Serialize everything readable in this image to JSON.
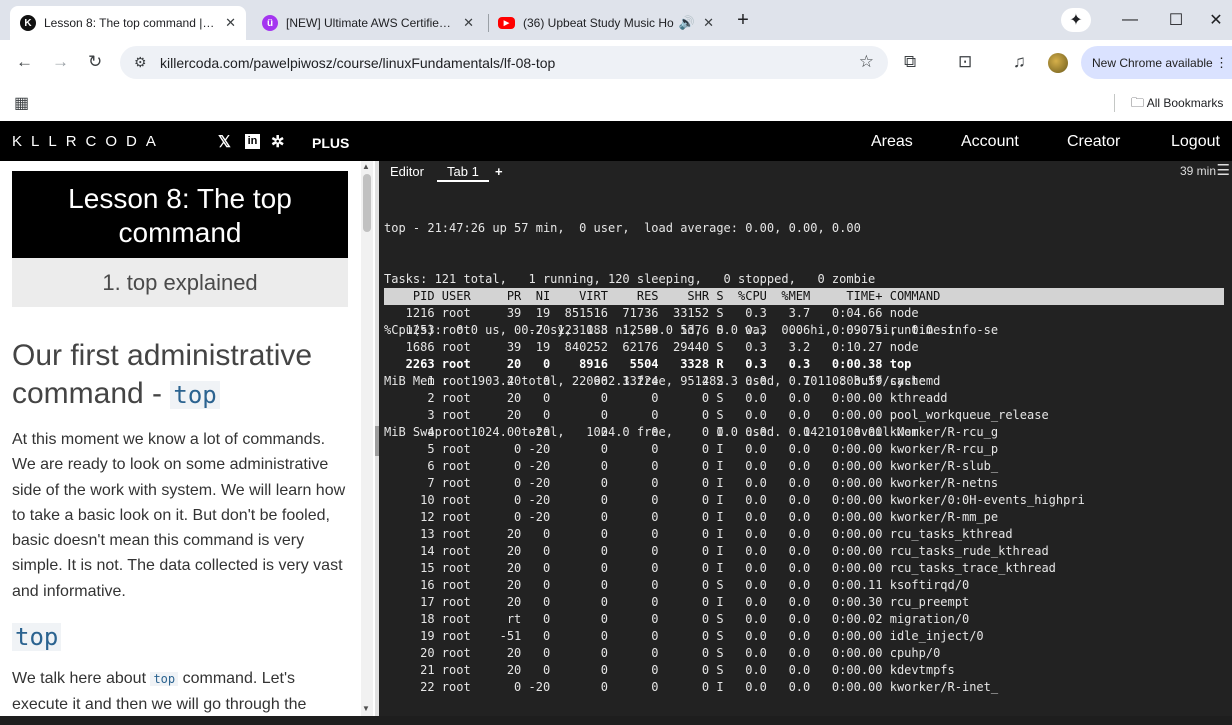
{
  "browser": {
    "tabs": [
      {
        "title": "Lesson 8: The top command | Pa",
        "favicon": "killercoda-icon",
        "active": true
      },
      {
        "title": "[NEW] Ultimate AWS Certified C",
        "favicon": "udemy-icon",
        "active": false
      },
      {
        "title": "(36) Upbeat Study Music Ho",
        "favicon": "youtube-icon",
        "active": false
      }
    ],
    "url": "killercoda.com/pawelpiwosz/course/linuxFundamentals/lf-08-top",
    "new_chrome": "New Chrome available",
    "all_bookmarks": "All Bookmarks"
  },
  "site": {
    "logo": "KLLRCODA",
    "plus": "PLUS",
    "nav": [
      "Areas",
      "Account",
      "Creator",
      "Logout"
    ]
  },
  "lesson": {
    "title": "Lesson 8: The top command",
    "step": "1. top explained",
    "heading_text": "Our first administrative command - ",
    "heading_code": "top",
    "paragraph": "At this moment we know a lot of commands. We are ready to look on some administrative side of the work with system. We will learn how to take a basic look on it. But don't be fooled, basic doesn't mean this command is very simple. It is not. The data collected is very vast and informative.",
    "subheading_code": "top",
    "para2_prefix": "We talk here about ",
    "para2_code": "top",
    "para2_suffix": " command. Let's execute it and then we will go through the"
  },
  "terminal": {
    "tabs": [
      "Editor",
      "Tab 1"
    ],
    "add_tab": "+",
    "timer": "39 min",
    "summary": [
      "top - 21:47:26 up 57 min,  0 user,  load average: 0.00, 0.00, 0.00",
      "Tasks: 121 total,   1 running, 120 sleeping,   0 stopped,   0 zombie",
      "%Cpu(s):  0.0 us,  0.7 sy,  0.3 ni, 99.0 id,  0.0 wa,  0.0 hi,  0.0 si,  0.0 st",
      "MiB Mem :   1903.4 total,    602.3 free,    482.3 used,   1011.8 buff/cache",
      "MiB Swap:   1024.0 total,   1024.0 free,      0.0 used.   1421.1 avail Mem"
    ],
    "columns": [
      "PID",
      "USER",
      "PR",
      "NI",
      "VIRT",
      "RES",
      "SHR",
      "S",
      "%CPU",
      "%MEM",
      "TIME+",
      "COMMAND"
    ],
    "processes": [
      [
        "1216",
        "root",
        "39",
        "19",
        "851516",
        "71736",
        "33152",
        "S",
        "0.3",
        "3.7",
        "0:04.66",
        "node"
      ],
      [
        "1253",
        "root",
        "0",
        "-20",
        "1231188",
        "12568",
        "5376",
        "S",
        "0.3",
        "0.6",
        "0:09.75",
        "runtime-info-se"
      ],
      [
        "1686",
        "root",
        "39",
        "19",
        "840252",
        "62176",
        "29440",
        "S",
        "0.3",
        "3.2",
        "0:10.27",
        "node"
      ],
      [
        "2263",
        "root",
        "20",
        "0",
        "8916",
        "5504",
        "3328",
        "R",
        "0.3",
        "0.3",
        "0:00.38",
        "top"
      ],
      [
        "1",
        "root",
        "20",
        "0",
        "22096",
        "13224",
        "9512",
        "S",
        "0.0",
        "0.7",
        "0:03.59",
        "systemd"
      ],
      [
        "2",
        "root",
        "20",
        "0",
        "0",
        "0",
        "0",
        "S",
        "0.0",
        "0.0",
        "0:00.00",
        "kthreadd"
      ],
      [
        "3",
        "root",
        "20",
        "0",
        "0",
        "0",
        "0",
        "S",
        "0.0",
        "0.0",
        "0:00.00",
        "pool_workqueue_release"
      ],
      [
        "4",
        "root",
        "0",
        "-20",
        "0",
        "0",
        "0",
        "I",
        "0.0",
        "0.0",
        "0:00.00",
        "kworker/R-rcu_g"
      ],
      [
        "5",
        "root",
        "0",
        "-20",
        "0",
        "0",
        "0",
        "I",
        "0.0",
        "0.0",
        "0:00.00",
        "kworker/R-rcu_p"
      ],
      [
        "6",
        "root",
        "0",
        "-20",
        "0",
        "0",
        "0",
        "I",
        "0.0",
        "0.0",
        "0:00.00",
        "kworker/R-slub_"
      ],
      [
        "7",
        "root",
        "0",
        "-20",
        "0",
        "0",
        "0",
        "I",
        "0.0",
        "0.0",
        "0:00.00",
        "kworker/R-netns"
      ],
      [
        "10",
        "root",
        "0",
        "-20",
        "0",
        "0",
        "0",
        "I",
        "0.0",
        "0.0",
        "0:00.00",
        "kworker/0:0H-events_highpri"
      ],
      [
        "12",
        "root",
        "0",
        "-20",
        "0",
        "0",
        "0",
        "I",
        "0.0",
        "0.0",
        "0:00.00",
        "kworker/R-mm_pe"
      ],
      [
        "13",
        "root",
        "20",
        "0",
        "0",
        "0",
        "0",
        "I",
        "0.0",
        "0.0",
        "0:00.00",
        "rcu_tasks_kthread"
      ],
      [
        "14",
        "root",
        "20",
        "0",
        "0",
        "0",
        "0",
        "I",
        "0.0",
        "0.0",
        "0:00.00",
        "rcu_tasks_rude_kthread"
      ],
      [
        "15",
        "root",
        "20",
        "0",
        "0",
        "0",
        "0",
        "I",
        "0.0",
        "0.0",
        "0:00.00",
        "rcu_tasks_trace_kthread"
      ],
      [
        "16",
        "root",
        "20",
        "0",
        "0",
        "0",
        "0",
        "S",
        "0.0",
        "0.0",
        "0:00.11",
        "ksoftirqd/0"
      ],
      [
        "17",
        "root",
        "20",
        "0",
        "0",
        "0",
        "0",
        "I",
        "0.0",
        "0.0",
        "0:00.30",
        "rcu_preempt"
      ],
      [
        "18",
        "root",
        "rt",
        "0",
        "0",
        "0",
        "0",
        "S",
        "0.0",
        "0.0",
        "0:00.02",
        "migration/0"
      ],
      [
        "19",
        "root",
        "-51",
        "0",
        "0",
        "0",
        "0",
        "S",
        "0.0",
        "0.0",
        "0:00.00",
        "idle_inject/0"
      ],
      [
        "20",
        "root",
        "20",
        "0",
        "0",
        "0",
        "0",
        "S",
        "0.0",
        "0.0",
        "0:00.00",
        "cpuhp/0"
      ],
      [
        "21",
        "root",
        "20",
        "0",
        "0",
        "0",
        "0",
        "S",
        "0.0",
        "0.0",
        "0:00.00",
        "kdevtmpfs"
      ],
      [
        "22",
        "root",
        "0",
        "-20",
        "0",
        "0",
        "0",
        "I",
        "0.0",
        "0.0",
        "0:00.00",
        "kworker/R-inet_"
      ]
    ]
  }
}
